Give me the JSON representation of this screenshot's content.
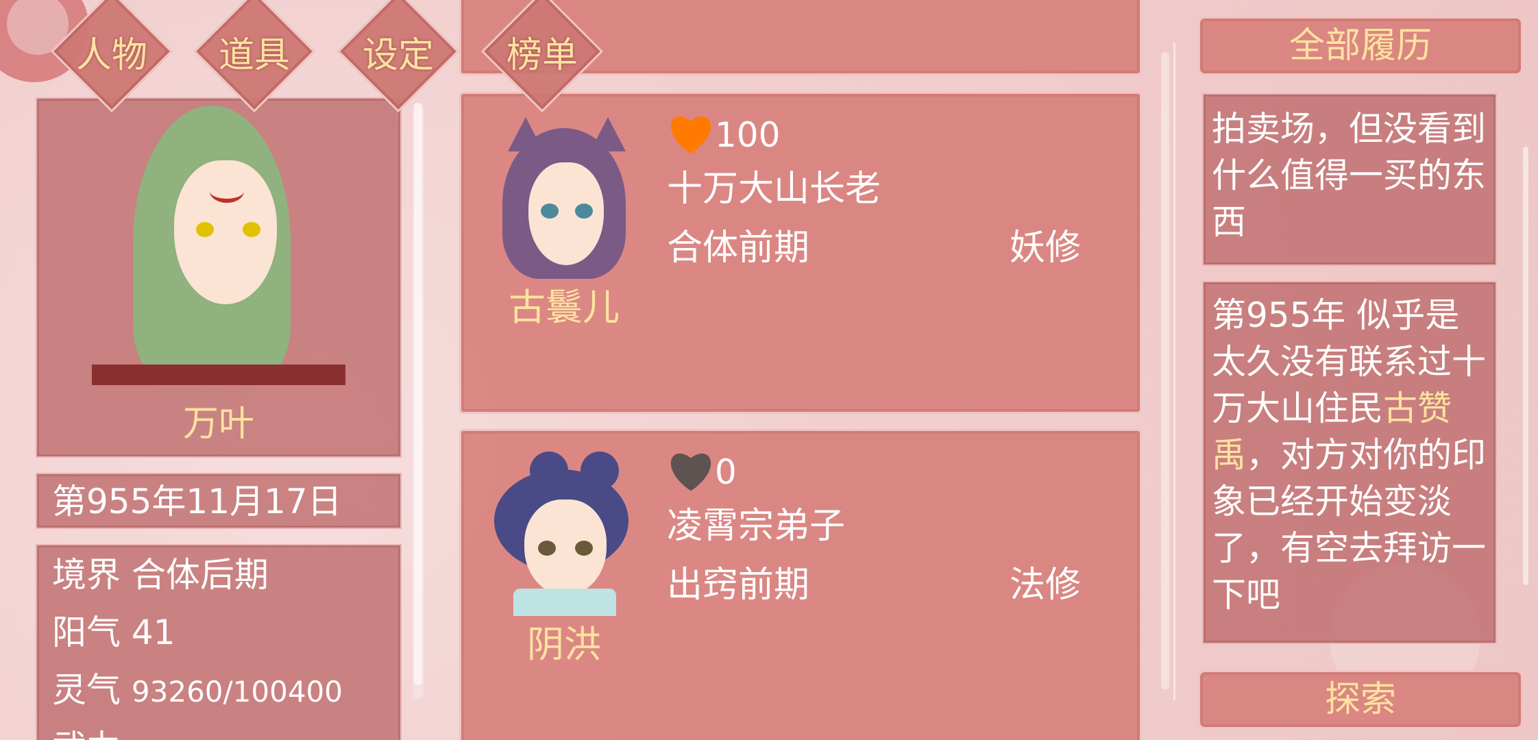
{
  "tabs": [
    {
      "label": "人物"
    },
    {
      "label": "道具"
    },
    {
      "label": "设定"
    },
    {
      "label": "榜单"
    }
  ],
  "player": {
    "name": "万叶",
    "date": "第955年11月17日",
    "stats": {
      "realm_label": "境界",
      "realm_value": "合体后期",
      "yang_label": "阳气",
      "yang_value": "41",
      "qi_label": "灵气",
      "qi_value": "93260/100400",
      "partial_label": "武力"
    }
  },
  "characters": [
    {
      "name": "古鬟儿",
      "affection": "100",
      "title": "十万大山长老",
      "realm": "合体前期",
      "type": "妖修",
      "heart_color": "#ff7a00"
    },
    {
      "name": "阴洪",
      "affection": "0",
      "title": "凌霄宗弟子",
      "realm": "出窍前期",
      "type": "法修",
      "heart_color": "#5e5350"
    }
  ],
  "history": {
    "header": "全部履历",
    "entry1": "拍卖场，但没看到什么值得一买的东西",
    "entry2": {
      "before": "第955年 似乎是太久没有联系过十万大山住民",
      "highlight": "古赞禹",
      "after": "，对方对你的印象已经开始变淡了，有空去拜访一下吧"
    },
    "explore_button": "探索"
  },
  "colors": {
    "gold": "#fde2a0",
    "panel": "#c06e6e",
    "heart_orange": "#ff7a00",
    "heart_gray": "#5e5350"
  }
}
